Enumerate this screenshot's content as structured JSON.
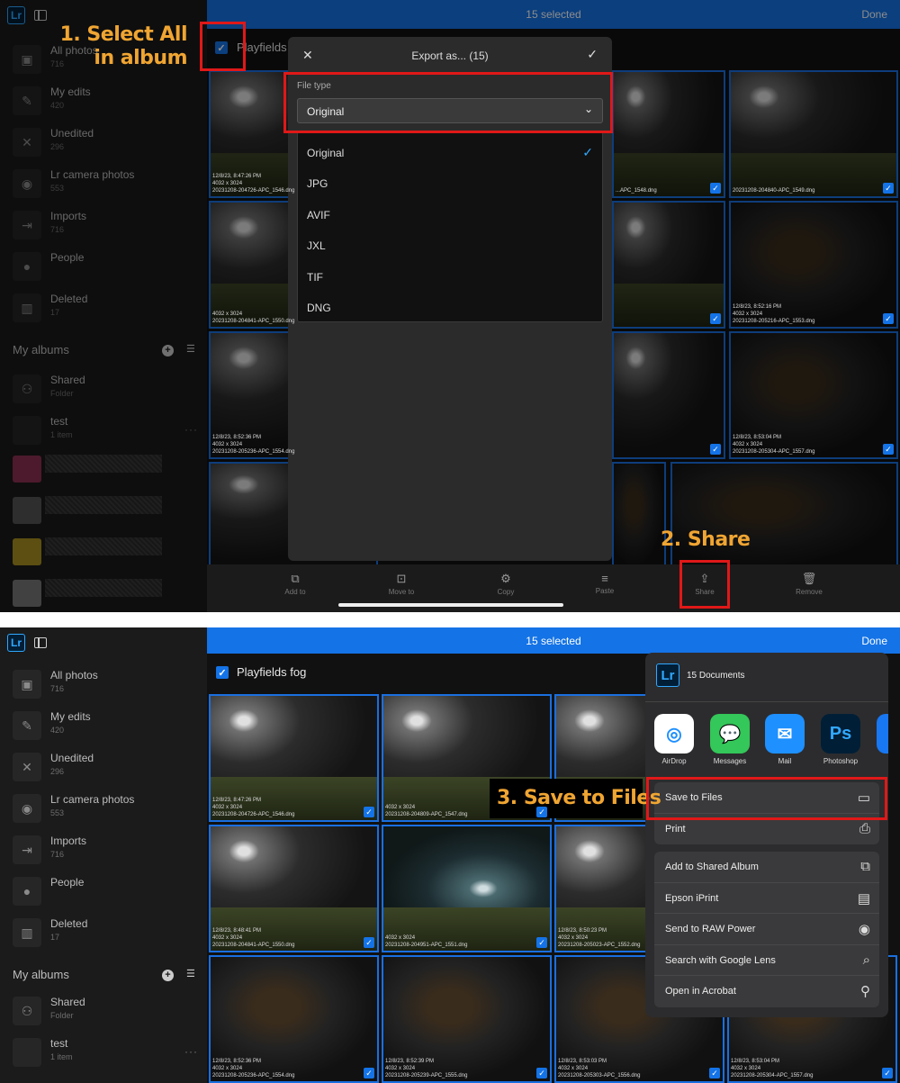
{
  "app": {
    "logo": "Lr",
    "selected": "15 selected",
    "done": "Done",
    "album_title": "Playfields fog",
    "album_title_short": "Playfields"
  },
  "sidebar": {
    "items": [
      {
        "label": "All photos",
        "count": "716",
        "icon": "image-icon"
      },
      {
        "label": "My edits",
        "count": "420",
        "icon": "pencil-icon"
      },
      {
        "label": "Unedited",
        "count": "296",
        "icon": "unedited-icon"
      },
      {
        "label": "Lr camera photos",
        "count": "553",
        "icon": "camera-icon"
      },
      {
        "label": "Imports",
        "count": "716",
        "icon": "import-icon"
      },
      {
        "label": "People",
        "count": "",
        "icon": "person-icon"
      },
      {
        "label": "Deleted",
        "count": "17",
        "icon": "trash-icon"
      }
    ],
    "albums_header": "My albums",
    "albums": [
      {
        "label": "Shared",
        "count": "Folder"
      },
      {
        "label": "test",
        "count": "1 item"
      }
    ],
    "more": "···"
  },
  "photos": [
    {
      "date": "12/8/23, 8:47:26 PM",
      "dims": "4032 x 3024",
      "file": "20231208-204726-APC_1546.dng"
    },
    {
      "date": "",
      "dims": "",
      "file": "20231208-204809-APC_1547.dng"
    },
    {
      "date": "",
      "dims": "",
      "file": "...APC_1548.dng"
    },
    {
      "date": "",
      "dims": "",
      "file": "20231208-204840-APC_1549.dng"
    },
    {
      "date": "12/8/23, 8:48:41 PM",
      "dims": "4032 x 3024",
      "file": "20231208-204841-APC_1550.dng"
    },
    {
      "date": "",
      "dims": "4032 x 3024",
      "file": "20231208-204951-APC_1551.dng"
    },
    {
      "date": "12/8/23, 8:50:23 PM",
      "dims": "4032 x 3024",
      "file": "20231208-205023-APC_1552.dng"
    },
    {
      "date": "12/8/23, 8:52:16 PM",
      "dims": "4032 x 3024",
      "file": "20231208-205216-APC_1553.dng"
    },
    {
      "date": "12/8/23, 8:52:36 PM",
      "dims": "4032 x 3024",
      "file": "20231208-205236-APC_1554.dng"
    },
    {
      "date": "12/8/23, 8:52:39 PM",
      "dims": "4032 x 3024",
      "file": "20231208-205239-APC_1555.dng"
    },
    {
      "date": "12/8/23, 8:53:03 PM",
      "dims": "4032 x 3024",
      "file": "20231208-205303-APC_1556.dng"
    },
    {
      "date": "12/8/23, 8:53:04 PM",
      "dims": "4032 x 3024",
      "file": "20231208-205304-APC_1557.dng"
    }
  ],
  "export_dialog": {
    "title": "Export as... (15)",
    "file_type_label": "File type",
    "selected": "Original",
    "options": [
      "Original",
      "JPG",
      "AVIF",
      "JXL",
      "TIF",
      "DNG"
    ]
  },
  "toolbar": {
    "items": [
      "Add to",
      "Move to",
      "Copy",
      "Paste",
      "Share",
      "Remove"
    ]
  },
  "callouts": {
    "step1_a": "1. Select All",
    "step1_b": "in album",
    "step2": "2. Share",
    "step3": "3. Save to Files"
  },
  "share_sheet": {
    "title": "15 Documents",
    "apps": [
      {
        "label": "AirDrop",
        "icon": "airdrop-icon",
        "color": "#ffffff"
      },
      {
        "label": "Messages",
        "icon": "messages-icon",
        "color": "#34c759"
      },
      {
        "label": "Mail",
        "icon": "mail-icon",
        "color": "#1e90ff"
      },
      {
        "label": "Photoshop",
        "icon": "photoshop-icon",
        "color": "#001e36"
      }
    ],
    "actions_a": [
      "Save to Files",
      "Print"
    ],
    "actions_b": [
      "Add to Shared Album",
      "Epson iPrint",
      "Send to RAW Power",
      "Search with Google Lens",
      "Open in Acrobat"
    ]
  },
  "colors": {
    "accent": "#1473e6",
    "callout": "#f0a532",
    "highlight": "#e01818"
  }
}
